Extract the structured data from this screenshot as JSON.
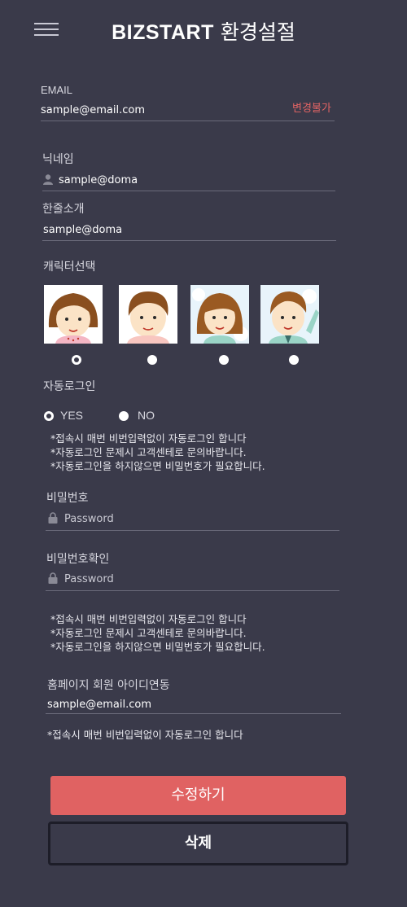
{
  "header": {
    "brand": "BIZSTART",
    "title": "환경설절"
  },
  "email": {
    "label": "EMAIL",
    "value": "sample@email.com",
    "note": "변경불가"
  },
  "nickname": {
    "label": "닉네임",
    "value": "sample@doma"
  },
  "intro": {
    "label": "한줄소개",
    "value": "sample@doma"
  },
  "character": {
    "label": "캐릭터선택",
    "options": [
      "girl-character",
      "boy-character",
      "girl-character-2",
      "boy-character-2"
    ],
    "selected_index": 0
  },
  "autologin": {
    "label": "자동로그인",
    "yes_label": "YES",
    "no_label": "NO",
    "selected": "YES",
    "notes": [
      "*접속시 매번 비번입력없이 자동로그인 합니다",
      "*자동로그인 문제시 고객센테로 문의바랍니다.",
      "*자동로그인을 하지않으면 비밀번호가 필요합니다."
    ]
  },
  "password": {
    "label": "비밀번호",
    "placeholder": "Password"
  },
  "password_confirm": {
    "label": "비밀번호확인",
    "placeholder": "Password",
    "notes": [
      "*접속시 매번 비번입력없이 자동로그인 합니다",
      "*자동로그인 문제시 고객센테로 문의바랍니다.",
      "*자동로그인을 하지않으면 비밀번호가 필요합니다."
    ]
  },
  "homepage_link": {
    "label": "홈페이지 회원 아이디연동",
    "value": "sample@email.com",
    "note": "*접속시 매번 비번입력없이 자동로그인 합니다"
  },
  "buttons": {
    "save": "수정하기",
    "delete": "삭제"
  },
  "colors": {
    "background": "#3a3a4a",
    "accent": "#e06262",
    "warning_text": "#e36464"
  }
}
